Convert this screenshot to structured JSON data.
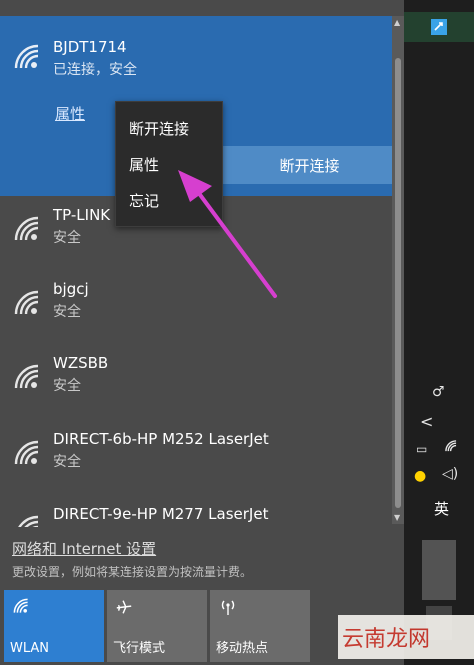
{
  "connected_network": {
    "name": "BJDT1714",
    "status": "已连接，安全",
    "properties_link": "属性",
    "disconnect_button": "断开连接"
  },
  "context_menu": {
    "items": [
      "断开连接",
      "属性",
      "忘记"
    ]
  },
  "networks": [
    {
      "name": "TP-LINK",
      "status": "安全"
    },
    {
      "name": "bjgcj",
      "status": "安全"
    },
    {
      "name": "WZSBB",
      "status": "安全"
    },
    {
      "name": "DIRECT-6b-HP M252 LaserJet",
      "status": "安全"
    },
    {
      "name": "DIRECT-9e-HP M277 LaserJet",
      "status": ""
    }
  ],
  "settings": {
    "link_label": "网络和 Internet 设置",
    "description": "更改设置，例如将某连接设置为按流量计费。"
  },
  "tiles": [
    {
      "label": "WLAN",
      "icon": "wifi-icon",
      "active": true
    },
    {
      "label": "飞行模式",
      "icon": "airplane-icon",
      "active": false
    },
    {
      "label": "移动热点",
      "icon": "hotspot-icon",
      "active": false
    }
  ],
  "taskbar": {
    "ime_label": "英"
  },
  "watermark": {
    "text": "云南龙网"
  },
  "colors": {
    "accent": "#2a6bb0",
    "tile_active": "#2e7fd1",
    "annotation_arrow": "#d63fcf"
  }
}
